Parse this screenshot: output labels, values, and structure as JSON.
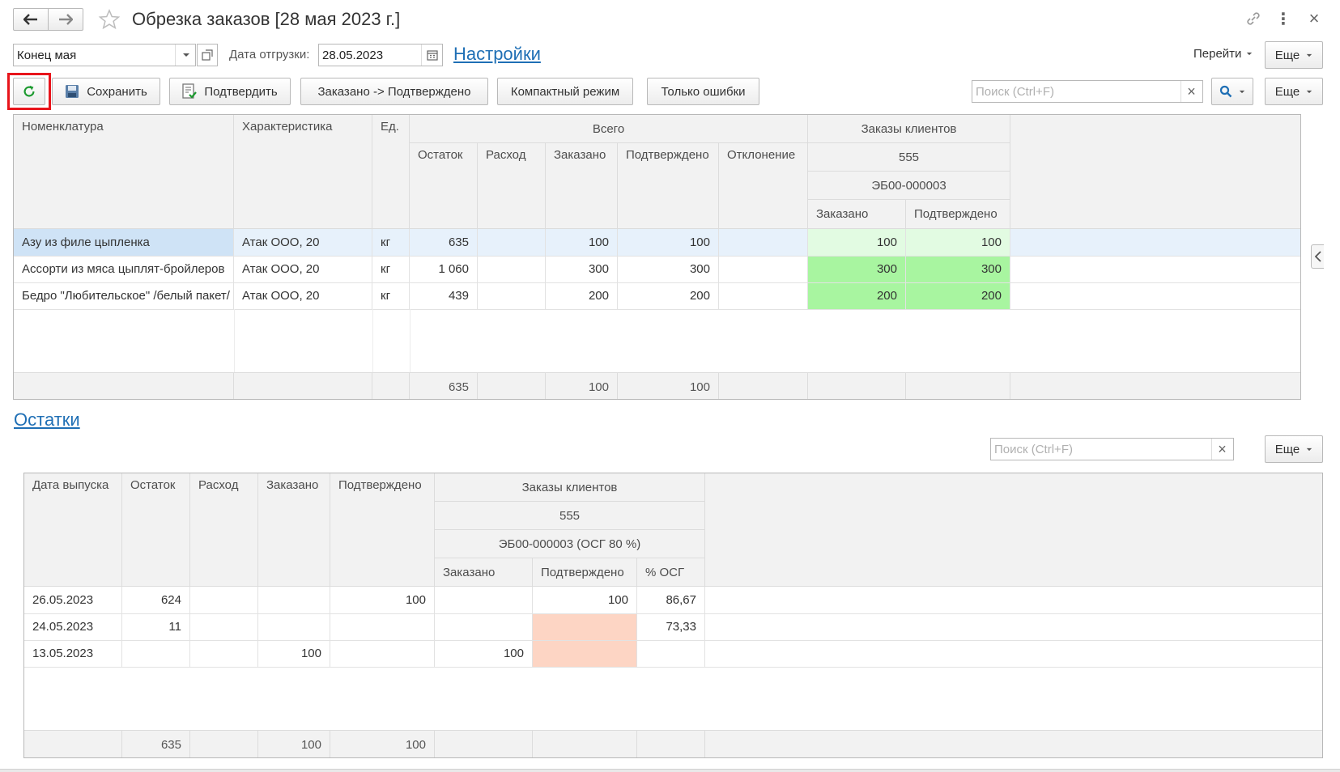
{
  "window": {
    "title": "Обрезка заказов [28 мая 2023 г.]",
    "more_icon": "⋮",
    "close_icon": "×"
  },
  "filters": {
    "period_value": "Конец мая",
    "ship_date_label": "Дата отгрузки:",
    "ship_date_value": "28.05.2023",
    "settings_link": "Настройки",
    "goto_label": "Перейти",
    "more_label": "Еще"
  },
  "toolbar": {
    "save_label": "Сохранить",
    "confirm_label": "Подтвердить",
    "ordered_to_confirmed_label": "Заказано -> Подтверждено",
    "compact_mode_label": "Компактный режим",
    "only_errors_label": "Только ошибки",
    "search_placeholder": "Поиск (Ctrl+F)",
    "more_label": "Еще"
  },
  "colors": {
    "highlight_red": "#e8141b",
    "green_light": "#e2fbe2",
    "green": "#a8f5a0",
    "salmon": "#fdd5c4",
    "selected_row": "#e7f1fb"
  },
  "grid1": {
    "headers": {
      "nomenclature": "Номенклатура",
      "characteristic": "Характеристика",
      "unit": "Ед.",
      "total": "Всего",
      "remainder": "Остаток",
      "expense": "Расход",
      "ordered": "Заказано",
      "confirmed": "Подтверждено",
      "deviation": "Отклонение",
      "client_orders": "Заказы клиентов",
      "order_number": "555",
      "order_code": "ЭБ00-000003",
      "sub_ordered": "Заказано",
      "sub_confirmed": "Подтверждено"
    },
    "rows": [
      {
        "name": "Азу из филе цыпленка",
        "characteristic": "Атак ООО, 20",
        "unit": "кг",
        "remainder": "635",
        "expense": "",
        "ordered": "100",
        "confirmed": "100",
        "deviation": "",
        "client_ordered": "100",
        "client_confirmed": "100"
      },
      {
        "name": "Ассорти из мяса цыплят-бройлеров",
        "characteristic": "Атак ООО, 20",
        "unit": "кг",
        "remainder": "1 060",
        "expense": "",
        "ordered": "300",
        "confirmed": "300",
        "deviation": "",
        "client_ordered": "300",
        "client_confirmed": "300"
      },
      {
        "name": "Бедро \"Любительское\" /белый пакет/",
        "characteristic": "Атак ООО, 20",
        "unit": "кг",
        "remainder": "439",
        "expense": "",
        "ordered": "200",
        "confirmed": "200",
        "deviation": "",
        "client_ordered": "200",
        "client_confirmed": "200"
      }
    ],
    "footer": {
      "remainder": "635",
      "ordered": "100",
      "confirmed": "100"
    }
  },
  "remainders_section": {
    "title": "Остатки",
    "search_placeholder": "Поиск (Ctrl+F)",
    "more_label": "Еще"
  },
  "grid2": {
    "headers": {
      "release_date": "Дата выпуска",
      "remainder": "Остаток",
      "expense": "Расход",
      "ordered": "Заказано",
      "confirmed": "Подтверждено",
      "client_orders": "Заказы клиентов",
      "order_number": "555",
      "order_code": "ЭБ00-000003 (ОСГ 80 %)",
      "sub_ordered": "Заказано",
      "sub_confirmed": "Подтверждено",
      "sub_osg": "% ОСГ"
    },
    "rows": [
      {
        "date": "26.05.2023",
        "remainder": "624",
        "expense": "",
        "ordered": "",
        "confirmed": "100",
        "client_ordered": "",
        "client_confirmed": "100",
        "osg": "86,67"
      },
      {
        "date": "24.05.2023",
        "remainder": "11",
        "expense": "",
        "ordered": "",
        "confirmed": "",
        "client_ordered": "",
        "client_confirmed": "",
        "osg": "73,33"
      },
      {
        "date": "13.05.2023",
        "remainder": "",
        "expense": "",
        "ordered": "100",
        "confirmed": "",
        "client_ordered": "100",
        "client_confirmed": "",
        "osg": ""
      }
    ],
    "footer": {
      "remainder": "635",
      "ordered": "100",
      "confirmed": "100"
    }
  }
}
